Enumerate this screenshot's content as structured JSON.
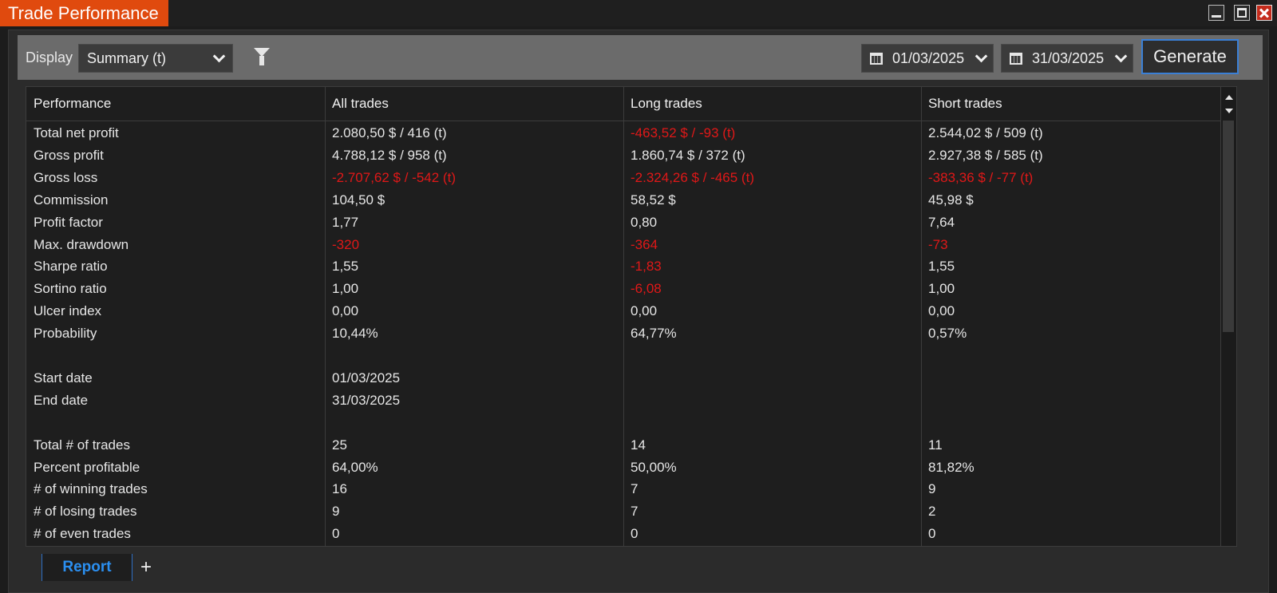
{
  "window": {
    "title": "Trade Performance"
  },
  "toolbar": {
    "display_label": "Display",
    "display_value": "Summary (t)",
    "start_date": "01/03/2025",
    "end_date": "31/03/2025",
    "generate_label": "Generate"
  },
  "grid": {
    "headers": [
      "Performance",
      "All trades",
      "Long trades",
      "Short trades"
    ],
    "rows": [
      [
        "Total net profit",
        "2.080,50 $ / 416 (t)",
        "-463,52 $ / -93 (t)",
        "2.544,02 $ / 509 (t)"
      ],
      [
        "Gross profit",
        "4.788,12 $ / 958 (t)",
        "1.860,74 $ / 372 (t)",
        "2.927,38 $ / 585 (t)"
      ],
      [
        "Gross loss",
        "-2.707,62 $ / -542 (t)",
        "-2.324,26 $ / -465 (t)",
        "-383,36 $ / -77 (t)"
      ],
      [
        "Commission",
        "104,50 $",
        "58,52 $",
        "45,98 $"
      ],
      [
        "Profit factor",
        "1,77",
        "0,80",
        "7,64"
      ],
      [
        "Max. drawdown",
        "-320",
        "-364",
        "-73"
      ],
      [
        "Sharpe ratio",
        "1,55",
        "-1,83",
        "1,55"
      ],
      [
        "Sortino ratio",
        "1,00",
        "-6,08",
        "1,00"
      ],
      [
        "Ulcer index",
        "0,00",
        "0,00",
        "0,00"
      ],
      [
        "Probability",
        "10,44%",
        "64,77%",
        "0,57%"
      ],
      [
        "",
        "",
        "",
        ""
      ],
      [
        "Start date",
        "01/03/2025",
        "",
        ""
      ],
      [
        "End date",
        "31/03/2025",
        "",
        ""
      ],
      [
        "",
        "",
        "",
        ""
      ],
      [
        "Total # of trades",
        "25",
        "14",
        "11"
      ],
      [
        "Percent profitable",
        "64,00%",
        "50,00%",
        "81,82%"
      ],
      [
        "# of winning trades",
        "16",
        "7",
        "9"
      ],
      [
        "# of losing trades",
        "9",
        "7",
        "2"
      ],
      [
        "# of even trades",
        "0",
        "0",
        "0"
      ]
    ]
  },
  "tabs": [
    {
      "label": "Report",
      "active": true
    }
  ],
  "add_tab_label": "+",
  "colors": {
    "title_tab": "#e04a0e",
    "negative": "#e01818",
    "accent": "#2b8ff0"
  },
  "icons": [
    "minimize-icon",
    "maximize-icon",
    "close-icon",
    "filter-icon",
    "calendar-icon",
    "chevron-down-icon",
    "scroll-up-icon",
    "scroll-down-icon"
  ]
}
